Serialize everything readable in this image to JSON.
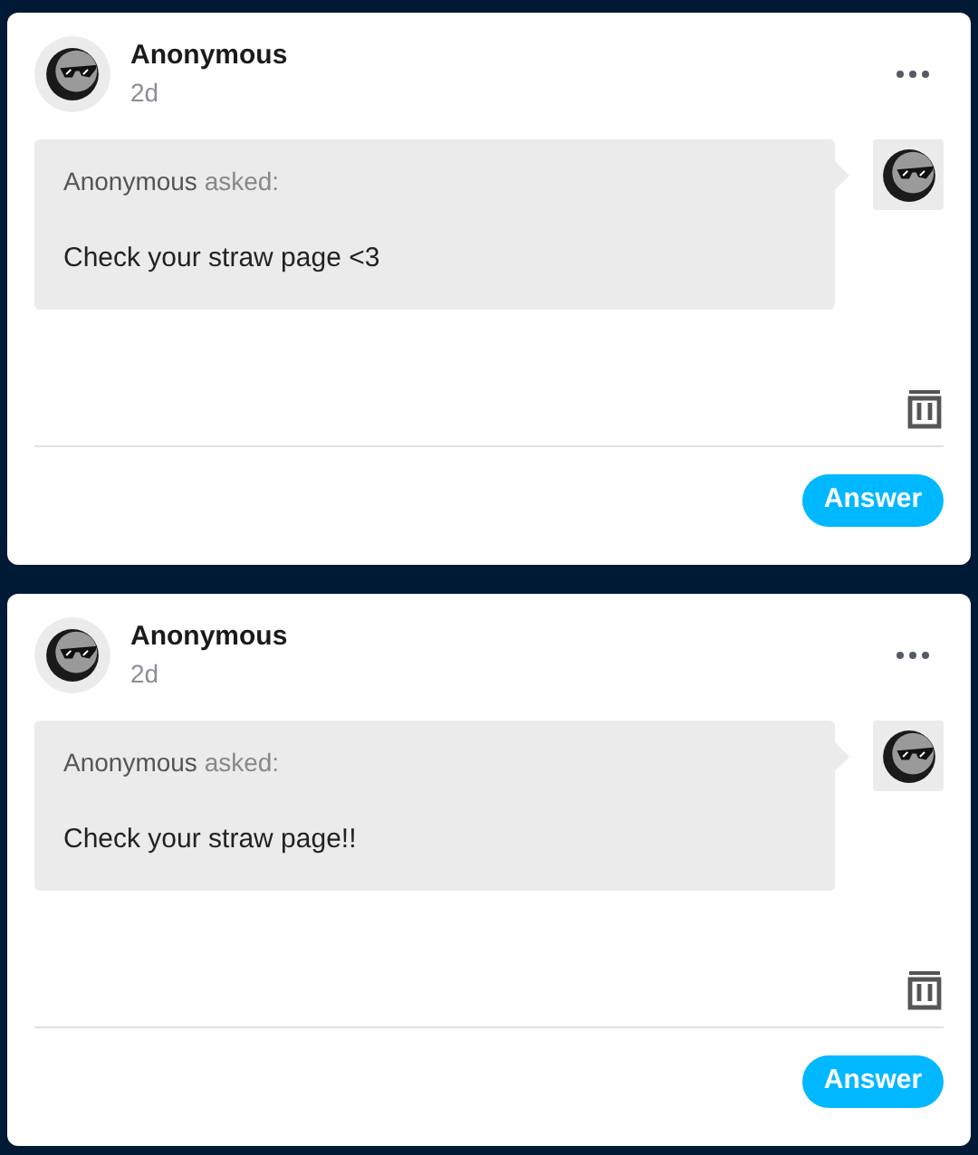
{
  "asks": [
    {
      "name": "Anonymous",
      "time": "2d",
      "asker": "Anonymous",
      "verb": "asked:",
      "message": "Check your straw page <3",
      "action": "Answer"
    },
    {
      "name": "Anonymous",
      "time": "2d",
      "asker": "Anonymous",
      "verb": "asked:",
      "message": "Check your straw page!!",
      "action": "Answer"
    }
  ]
}
